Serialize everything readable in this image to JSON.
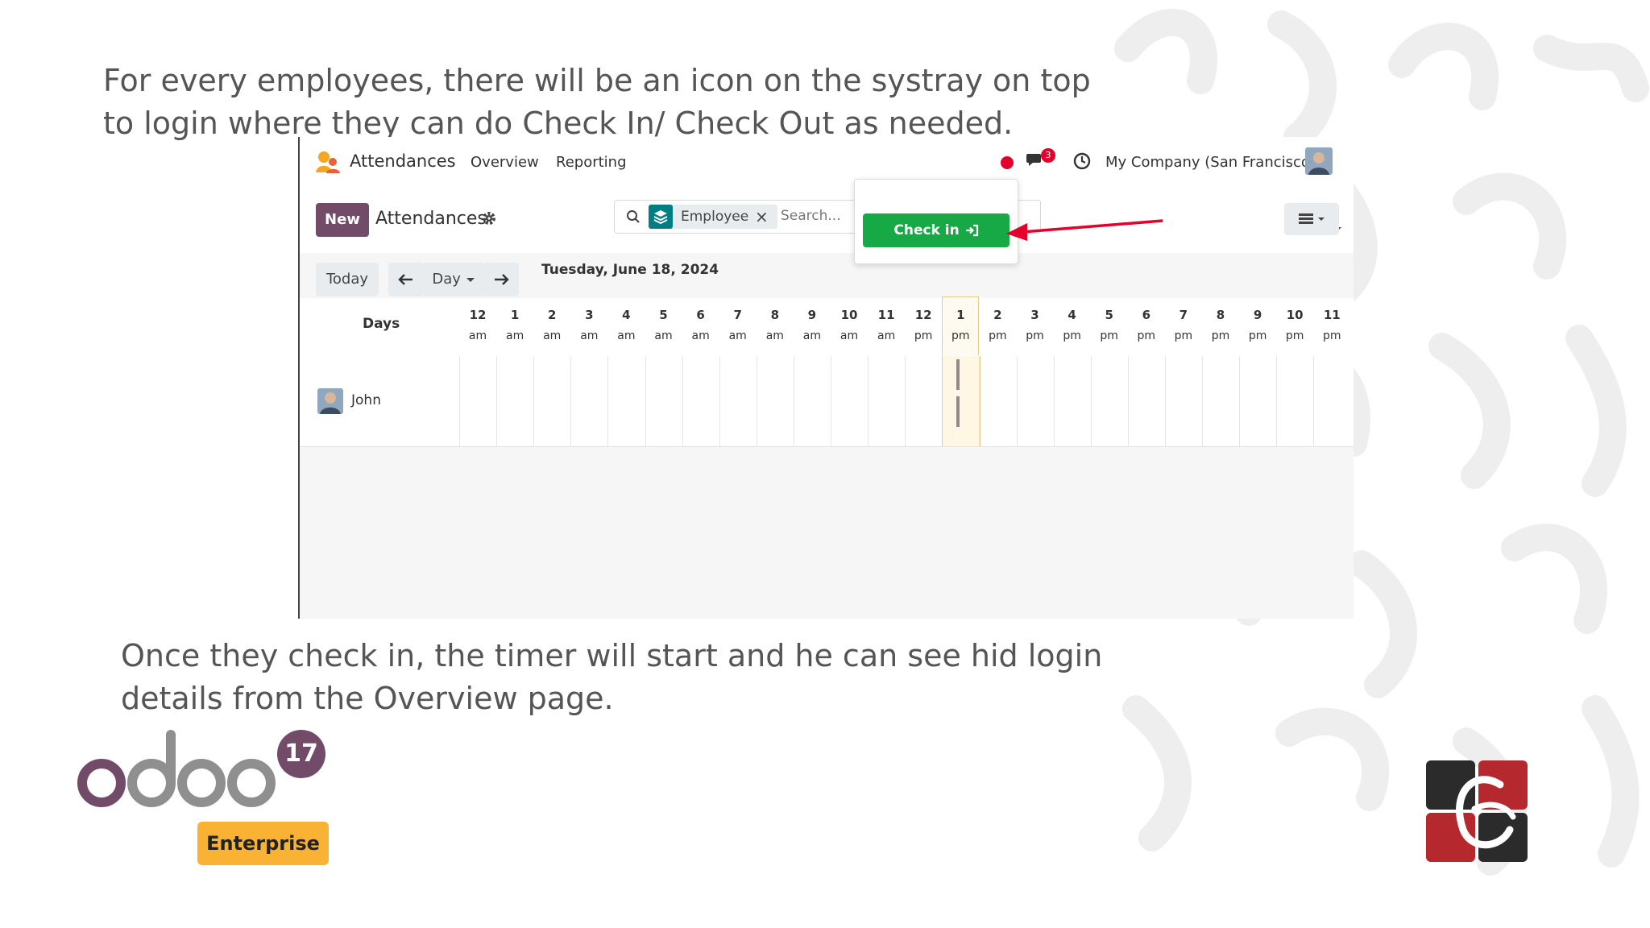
{
  "slide": {
    "top_text": "For every employees, there will be an icon on the systray on top to login where they can do Check In/ Check Out as needed.",
    "bottom_text": "Once they check in, the timer will start and he can see hid login details from the Overview page."
  },
  "app": {
    "name": "Attendances",
    "menu": [
      "Overview",
      "Reporting"
    ],
    "chat_count": "3",
    "company": "My Company (San Francisco)"
  },
  "control": {
    "new_label": "New",
    "title": "Attendances",
    "facet_label": "Employee",
    "facet_remove": "×",
    "search_placeholder": "Search..."
  },
  "checkin": {
    "label": "Check in"
  },
  "datebar": {
    "today_label": "Today",
    "scale_label": "Day",
    "date": "Tuesday, June 18, 2024"
  },
  "grid": {
    "rows_header": "Days",
    "hours": [
      {
        "num": "12",
        "ampm": "am"
      },
      {
        "num": "1",
        "ampm": "am"
      },
      {
        "num": "2",
        "ampm": "am"
      },
      {
        "num": "3",
        "ampm": "am"
      },
      {
        "num": "4",
        "ampm": "am"
      },
      {
        "num": "5",
        "ampm": "am"
      },
      {
        "num": "6",
        "ampm": "am"
      },
      {
        "num": "7",
        "ampm": "am"
      },
      {
        "num": "8",
        "ampm": "am"
      },
      {
        "num": "9",
        "ampm": "am"
      },
      {
        "num": "10",
        "ampm": "am"
      },
      {
        "num": "11",
        "ampm": "am"
      },
      {
        "num": "12",
        "ampm": "pm"
      },
      {
        "num": "1",
        "ampm": "pm"
      },
      {
        "num": "2",
        "ampm": "pm"
      },
      {
        "num": "3",
        "ampm": "pm"
      },
      {
        "num": "4",
        "ampm": "pm"
      },
      {
        "num": "5",
        "ampm": "pm"
      },
      {
        "num": "6",
        "ampm": "pm"
      },
      {
        "num": "7",
        "ampm": "pm"
      },
      {
        "num": "8",
        "ampm": "pm"
      },
      {
        "num": "9",
        "ampm": "pm"
      },
      {
        "num": "10",
        "ampm": "pm"
      },
      {
        "num": "11",
        "ampm": "pm"
      }
    ],
    "current_hour_index": 13,
    "employee": "John"
  },
  "branding": {
    "version": "17",
    "edition": "Enterprise"
  },
  "colors": {
    "primary": "#714b67",
    "checkin": "#18a947",
    "arrow": "#e4002b",
    "enterprise": "#f9b233"
  }
}
